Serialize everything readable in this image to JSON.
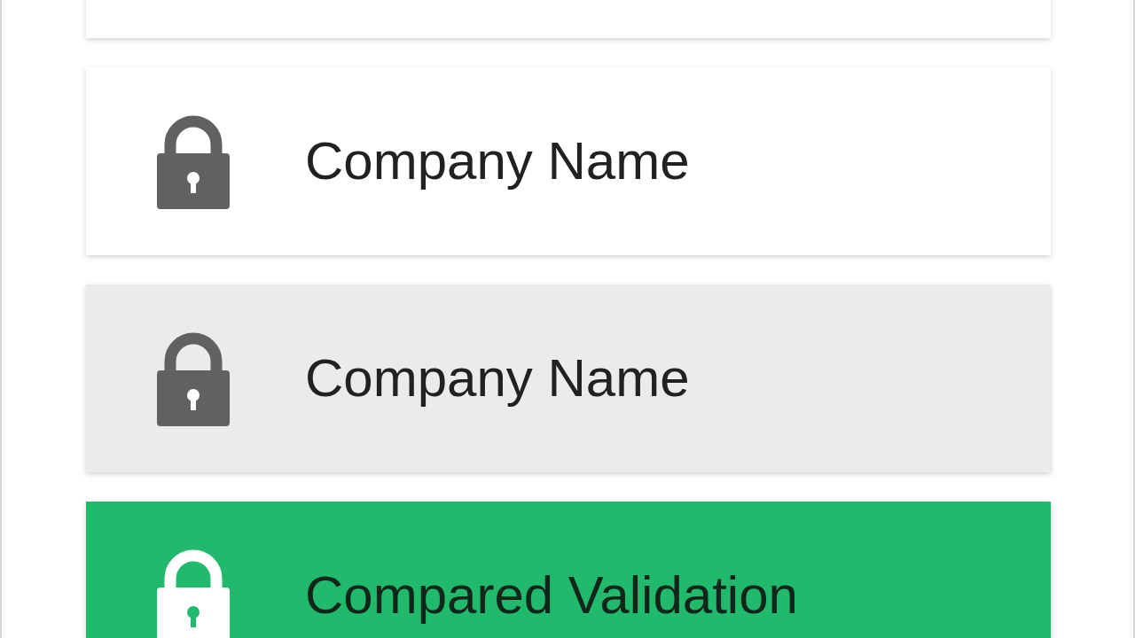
{
  "cards": [
    {
      "kind": "default"
    },
    {
      "kind": "default",
      "label": "Company Name"
    },
    {
      "kind": "pressed",
      "label": "Company Name"
    },
    {
      "kind": "success",
      "label": "Compared Validation"
    }
  ]
}
